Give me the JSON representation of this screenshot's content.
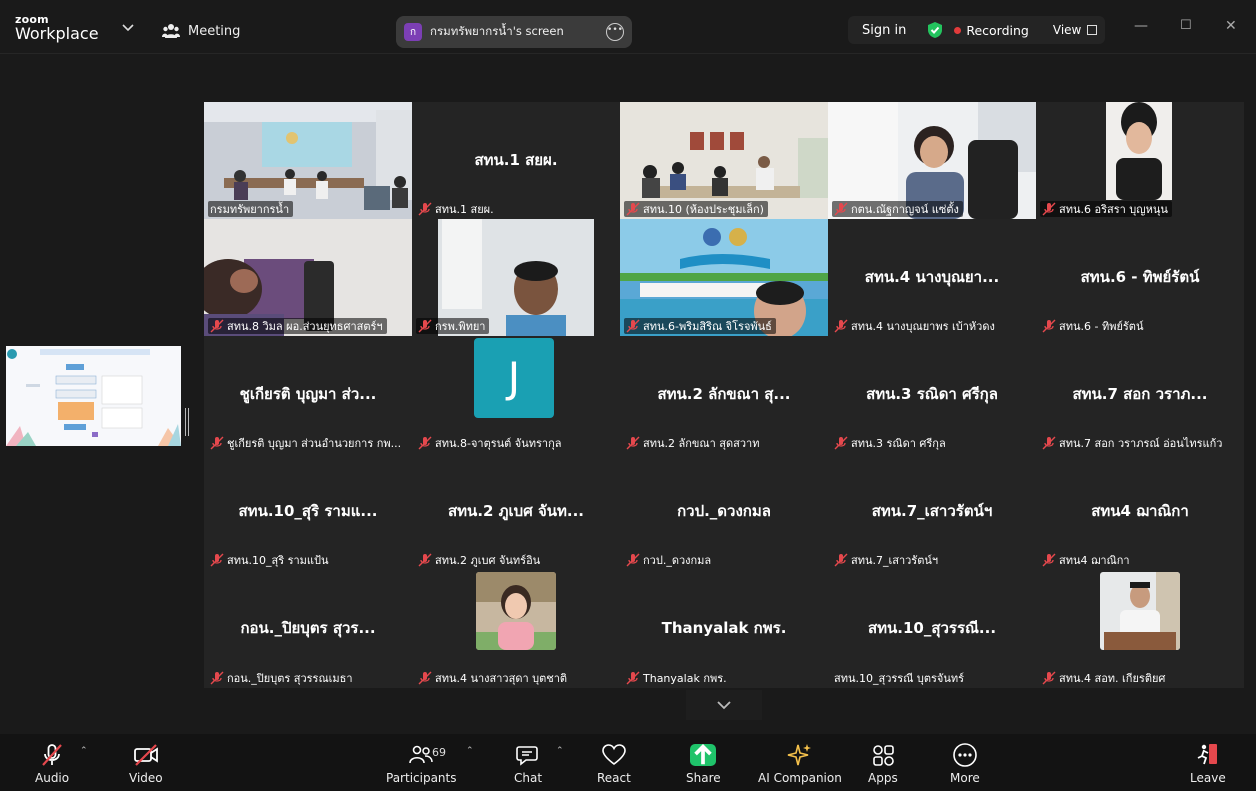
{
  "app": {
    "logo_top": "zoom",
    "logo_bottom": "Workplace",
    "meeting_label": "Meeting",
    "screen_badge": "ก",
    "screen_share_title": "กรมทรัพยากรน้ำ's screen",
    "sign_in": "Sign in",
    "recording": "Recording",
    "view": "View"
  },
  "tiles": [
    {
      "id": "t1",
      "big": "",
      "name": "กรมทรัพยากรน้ำ",
      "video": true
    },
    {
      "id": "t2",
      "big": "สทน.1 สยผ.",
      "name": "สทน.1 สยผ.",
      "video": false
    },
    {
      "id": "t3",
      "big": "",
      "name": "สทน.10 (ห้องประชุมเล็ก)",
      "video": true
    },
    {
      "id": "t4",
      "big": "",
      "name": "กตน.ณัฐกาญจน์ แซ่ตั้ง",
      "video": true
    },
    {
      "id": "t5",
      "big": "",
      "name": "สทน.6 อริสรา บุญหนุน",
      "video": true
    },
    {
      "id": "t6",
      "big": "",
      "name": "สทน.8 วิมล ผอ.ส่วนยุทธศาสตร์ฯ",
      "video": true
    },
    {
      "id": "t7",
      "big": "",
      "name": "กรพ.พิทยา",
      "video": true
    },
    {
      "id": "t8",
      "big": "",
      "name": "สทน.6-พริมสิริณ จิโรจพันธ์",
      "video": true
    },
    {
      "id": "t9",
      "big": "สทน.4 นางบุณยา...",
      "name": "สทน.4 นางบุณยาพร เบ้าหัวดง",
      "video": false
    },
    {
      "id": "t10",
      "big": "สทน.6 - ทิพย์รัตน์",
      "name": "สทน.6 - ทิพย์รัตน์",
      "video": false
    },
    {
      "id": "t11",
      "big": "ชูเกียรติ บุญมา ส่ว...",
      "name": "ชูเกียรติ บุญมา ส่วนอำนวยการ กพ...",
      "video": false
    },
    {
      "id": "t12",
      "big": "",
      "name": "สทน.8-จาตุรนต์ จันทรากุล",
      "video": false,
      "initial": "J"
    },
    {
      "id": "t13",
      "big": "สทน.2 ลักขณา สุ...",
      "name": "สทน.2 ลักขณา สุดสวาท",
      "video": false
    },
    {
      "id": "t14",
      "big": "สทน.3 รณิดา ศรีกุล",
      "name": "สทน.3 รณิดา ศรีกุล",
      "video": false
    },
    {
      "id": "t15",
      "big": "สทน.7 สอก วราภ...",
      "name": "สทน.7 สอก วราภรณ์ อ่อนไทรแก้ว",
      "video": false
    },
    {
      "id": "t16",
      "big": "สทน.10_สุริ รามแ...",
      "name": "สทน.10_สุริ รามแป้น",
      "video": false
    },
    {
      "id": "t17",
      "big": "สทน.2 ภูเบศ จันท...",
      "name": "สทน.2 ภูเบศ จันทร์อิน",
      "video": false
    },
    {
      "id": "t18",
      "big": "กวป._ดวงกมล",
      "name": "กวป._ดวงกมล",
      "video": false
    },
    {
      "id": "t19",
      "big": "สทน.7_เสาวรัตน์ฯ",
      "name": "สทน.7_เสาวรัตน์ฯ",
      "video": false
    },
    {
      "id": "t20",
      "big": "สทน4 ฌาณิกา",
      "name": "สทน4 ฌาณิกา",
      "video": false
    },
    {
      "id": "t21",
      "big": "กอน._ปิยบุตร สุวร...",
      "name": "กอน._ปิยบุตร สุวรรณเมธา",
      "video": false
    },
    {
      "id": "t22",
      "big": "",
      "name": "สทน.4 นางสาวสุดา บุตชาติ",
      "video": false,
      "photo": true
    },
    {
      "id": "t23",
      "big": "Thanyalak กพร.",
      "name": "Thanyalak กพร.",
      "video": false
    },
    {
      "id": "t24",
      "big": "สทน.10_สุวรรณี...",
      "name": "สทน.10_สุวรรณี  บุตรจันทร์",
      "video": false,
      "nomic": true
    },
    {
      "id": "t25",
      "big": "",
      "name": "สทน.4 สอท. เกียรติยศ",
      "video": false,
      "photo": true
    }
  ],
  "toolbar": {
    "audio": "Audio",
    "video": "Video",
    "participants": "Participants",
    "participants_count": "69",
    "chat": "Chat",
    "react": "React",
    "share": "Share",
    "ai": "AI Companion",
    "apps": "Apps",
    "more": "More",
    "leave": "Leave"
  },
  "colors": {
    "active_speaker": "#24d06b",
    "mic_muted": "#e5484d",
    "share_green": "#1fc36a",
    "avatar_teal": "#1aa0b3"
  }
}
